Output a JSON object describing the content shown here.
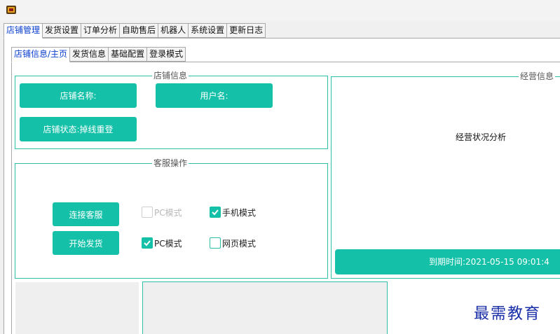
{
  "app": {
    "icon": "app-logo-icon"
  },
  "main_tabs": [
    {
      "label": "店铺管理",
      "active": true
    },
    {
      "label": "发货设置"
    },
    {
      "label": "订单分析"
    },
    {
      "label": "自助售后"
    },
    {
      "label": "机器人"
    },
    {
      "label": "系统设置"
    },
    {
      "label": "更新日志"
    }
  ],
  "sub_tabs": [
    {
      "label": "店铺信息/主页",
      "active": true
    },
    {
      "label": "发货信息"
    },
    {
      "label": "基础配置"
    },
    {
      "label": "登录模式"
    }
  ],
  "shop_info": {
    "legend": "店铺信息",
    "shop_name_label": "店铺名称:",
    "username_label": "用户名:",
    "status_label": "店铺状态:掉线重登"
  },
  "customer_service": {
    "legend": "客服操作",
    "connect_button": "连接客服",
    "ship_button": "开始发货",
    "options": [
      {
        "label": "PC模式",
        "checked": false,
        "disabled": true
      },
      {
        "label": "手机模式",
        "checked": true,
        "disabled": false
      },
      {
        "label": "PC模式",
        "checked": true,
        "disabled": false
      },
      {
        "label": "网页模式",
        "checked": false,
        "disabled": false
      }
    ]
  },
  "business_info": {
    "legend": "经营信息",
    "analysis_text": "经营状况分析",
    "expiry_text": "到期时间:2021-05-15 09:01:4"
  },
  "watermark": "最需教育",
  "colors": {
    "accent": "#14c1a8",
    "tab_active": "#0a3fcf",
    "watermark": "#1a2ea8"
  }
}
